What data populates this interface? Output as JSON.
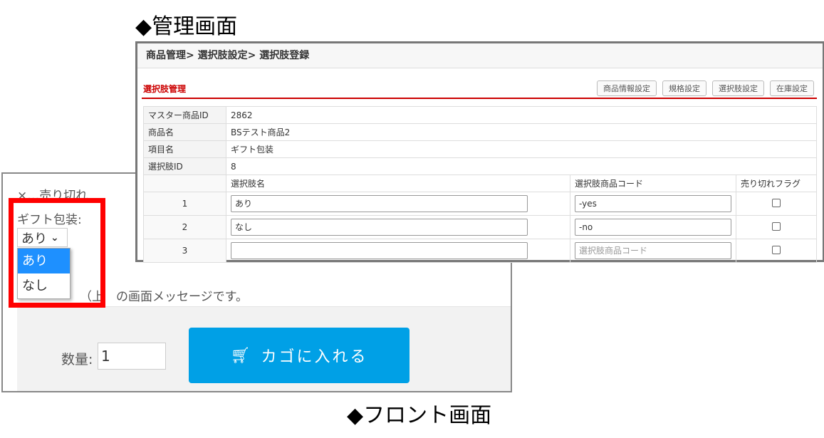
{
  "captions": {
    "admin": "◆管理画面",
    "front": "◆フロント画面"
  },
  "front": {
    "soldout_note": "×…売り切れ",
    "option_label": "ギフト包装:",
    "select_value": "あり",
    "options": [
      "あり",
      "なし"
    ],
    "message": "（上　の画面メッセージです。",
    "qty_label": "数量:",
    "qty_value": "1",
    "cart_button": "カゴに入れる",
    "accent": "#00a0e6",
    "highlight_color": "#f00"
  },
  "admin": {
    "breadcrumb": "商品管理> 選択肢設定> 選択肢登録",
    "section_title": "選択肢管理",
    "tabs": [
      "商品情報設定",
      "規格設定",
      "選択肢設定",
      "在庫設定"
    ],
    "info": [
      {
        "label": "マスター商品ID",
        "value": "2862"
      },
      {
        "label": "商品名",
        "value": "BSテスト商品2"
      },
      {
        "label": "項目名",
        "value": "ギフト包装"
      },
      {
        "label": "選択肢ID",
        "value": "8"
      }
    ],
    "columns": [
      "選択肢名",
      "選択肢商品コード",
      "売り切れフラグ"
    ],
    "rows": [
      {
        "no": "1",
        "name": "あり",
        "code": "-yes"
      },
      {
        "no": "2",
        "name": "なし",
        "code": "-no"
      },
      {
        "no": "3",
        "name": "",
        "code": ""
      }
    ],
    "code_placeholder": "選択肢商品コード"
  }
}
